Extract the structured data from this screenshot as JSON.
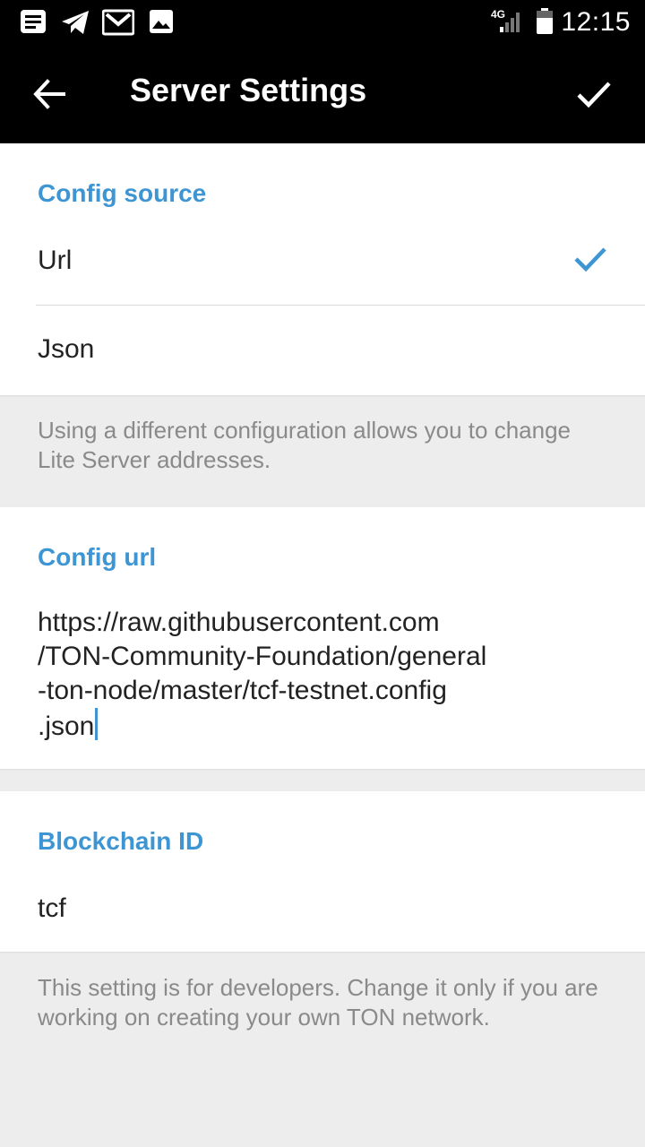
{
  "status_bar": {
    "network": "4G",
    "time": "12:15",
    "icons": [
      "notes-icon",
      "telegram-icon",
      "gmail-icon",
      "image-icon",
      "signal-icon",
      "battery-icon"
    ]
  },
  "toolbar": {
    "title": "Server Settings",
    "back_icon": "arrow-left-icon",
    "done_icon": "checkmark-icon"
  },
  "config_source": {
    "header": "Config source",
    "options": [
      {
        "label": "Url",
        "selected": true
      },
      {
        "label": "Json",
        "selected": false
      }
    ],
    "hint": "Using a different configuration allows you to change Lite Server addresses."
  },
  "config_url": {
    "header": "Config url",
    "value": "https://raw.githubusercontent.com/TON-Community-Foundation/general-ton-node/master/tcf-testnet.config.json",
    "lines": [
      "https://raw.githubusercontent.com",
      "/TON-Community-Foundation/general",
      "-ton-node/master/tcf-testnet.config",
      ".json"
    ]
  },
  "blockchain": {
    "header": "Blockchain ID",
    "value": "tcf",
    "hint": "This setting is for developers. Change it only if you are working on creating your own TON network."
  },
  "colors": {
    "accent": "#3d95d3",
    "toolbar_bg": "#000000",
    "page_bg": "#ededed",
    "hint_text": "#8a8a8a"
  }
}
